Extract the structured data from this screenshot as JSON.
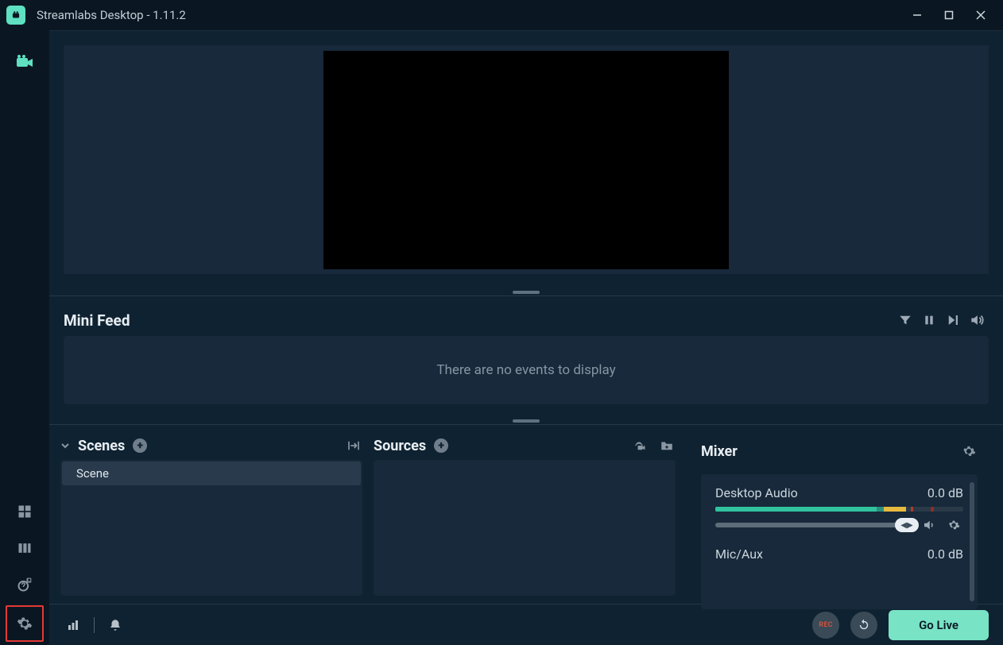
{
  "window": {
    "title": "Streamlabs Desktop - 1.11.2"
  },
  "minifeed": {
    "title": "Mini Feed",
    "empty_text": "There are no events to display"
  },
  "panels": {
    "scenes": {
      "title": "Scenes",
      "items": [
        "Scene"
      ]
    },
    "sources": {
      "title": "Sources"
    },
    "mixer": {
      "title": "Mixer",
      "tracks": [
        {
          "name": "Desktop Audio",
          "db": "0.0 dB"
        },
        {
          "name": "Mic/Aux",
          "db": "0.0 dB"
        }
      ]
    }
  },
  "footer": {
    "rec_label": "REC",
    "go_live": "Go Live"
  }
}
